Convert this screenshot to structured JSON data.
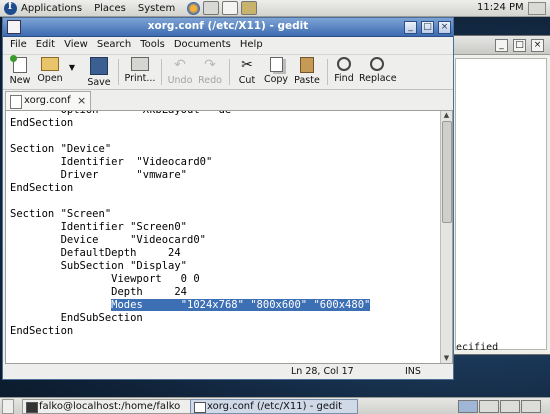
{
  "top_panel": {
    "menus": [
      "Applications",
      "Places",
      "System"
    ],
    "clock": "11:24 PM"
  },
  "gedit": {
    "title": "xorg.conf (/etc/X11) - gedit",
    "menus": [
      "File",
      "Edit",
      "View",
      "Search",
      "Tools",
      "Documents",
      "Help"
    ],
    "toolbar": {
      "new": "New",
      "open": "Open",
      "save": "Save",
      "print": "Print...",
      "undo": "Undo",
      "redo": "Redo",
      "cut": "Cut",
      "copy": "Copy",
      "paste": "Paste",
      "find": "Find",
      "replace": "Replace"
    },
    "tab_label": "xorg.conf",
    "code": {
      "l0": "EndSection",
      "l1": "",
      "l2": "Section \"Device\"",
      "l3": "        Identifier  \"Videocard0\"",
      "l4": "        Driver      \"vmware\"",
      "l5": "EndSection",
      "l6": "",
      "l7": "Section \"Screen\"",
      "l8": "        Identifier \"Screen0\"",
      "l9": "        Device     \"Videocard0\"",
      "l10": "        DefaultDepth     24",
      "l11": "        SubSection \"Display\"",
      "l12": "                Viewport   0 0",
      "l13": "                Depth     24",
      "l14_indent": "                ",
      "l14_selected": "Modes      \"1024x768\" \"800x600\" \"600x480\"",
      "l15": "        EndSubSection",
      "l16": "EndSection"
    },
    "status": {
      "position": "Ln 28, Col 17",
      "mode": "INS"
    }
  },
  "background_window": {
    "visible_text": "ecified"
  },
  "taskbar": {
    "tasks": [
      "falko@localhost:/home/falko",
      "xorg.conf (/etc/X11) - gedit"
    ]
  }
}
